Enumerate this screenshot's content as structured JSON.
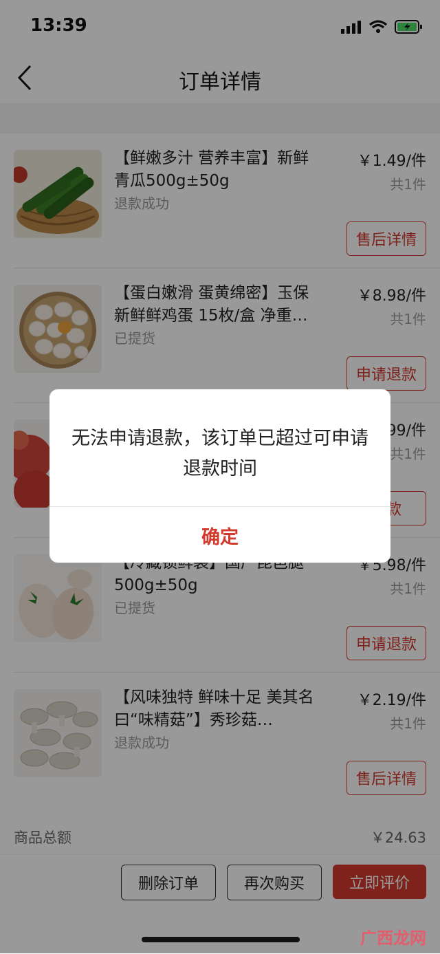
{
  "status": {
    "time": "13:39"
  },
  "nav": {
    "title": "订单详情"
  },
  "partial_header_text": "",
  "items": [
    {
      "name": "【鲜嫩多汁 营养丰富】新鲜青瓜500g±50g",
      "state": "退款成功",
      "price": "￥1.49/件",
      "qty": "共1件",
      "button": "售后详情"
    },
    {
      "name": "【蛋白嫩滑 蛋黄绵密】玉保新鲜鲜鸡蛋 15枚/盒 净重…",
      "state": "已提货",
      "price": "￥8.98/件",
      "qty": "共1件",
      "button": "申请退款"
    },
    {
      "name": "",
      "state": "",
      "price": "99/件",
      "qty": "共1件",
      "button": "退款"
    },
    {
      "name": "【冷藏锁鲜装】国产琵琶腿500g±50g",
      "state": "已提货",
      "price": "￥5.98/件",
      "qty": "共1件",
      "button": "申请退款"
    },
    {
      "name": "【风味独特 鲜味十足 美其名曰“味精菇”】秀珍菇…",
      "state": "退款成功",
      "price": "￥2.19/件",
      "qty": "共1件",
      "button": "售后详情"
    }
  ],
  "summary": {
    "label": "商品总额",
    "value": "￥24.63"
  },
  "actions": {
    "delete": "删除订单",
    "rebuy": "再次购买",
    "review": "立即评价"
  },
  "dialog": {
    "message": "无法申请退款，该订单已超过可申请退款时间",
    "confirm": "确定"
  },
  "watermark": "广西龙网",
  "colors": {
    "accent": "#d23a2e",
    "overlay": "rgba(0,0,0,0.4)"
  }
}
